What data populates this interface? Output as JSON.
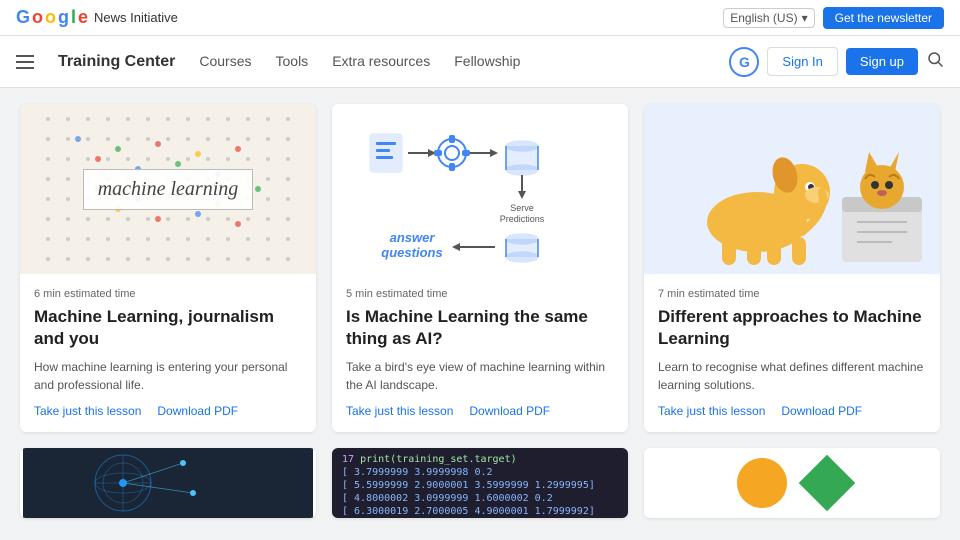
{
  "topbar": {
    "google_text": "Google",
    "title": "News Initiative",
    "language": "English (US)",
    "newsletter_btn": "Get the newsletter"
  },
  "navbar": {
    "training_center": "Training Center",
    "links": [
      "Courses",
      "Tools",
      "Extra resources",
      "Fellowship"
    ],
    "sign_in": "Sign In",
    "sign_up": "Sign up"
  },
  "cards": [
    {
      "time": "6 min estimated time",
      "title": "Machine Learning, journalism and you",
      "desc": "How machine learning is entering your personal and professional life.",
      "link1": "Take just this lesson",
      "link2": "Download PDF"
    },
    {
      "time": "5 min estimated time",
      "title": "Is Machine Learning the same thing as AI?",
      "desc": "Take a bird's eye view of machine learning within the AI landscape.",
      "link1": "Take just this lesson",
      "link2": "Download PDF"
    },
    {
      "time": "7 min estimated time",
      "title": "Different approaches to Machine Learning",
      "desc": "Learn to recognise what defines different machine learning solutions.",
      "link1": "Take just this lesson",
      "link2": "Download PDF"
    }
  ],
  "code_snippet": {
    "line1": "print(training_set.target)",
    "line_num": "17",
    "rows": [
      "[ 3.7999999  3.9999998  0.2",
      "[ 5.5999999  2.9000001  3.5999999  1.2999995]",
      "[ 4.8000002  3.0999999  1.6000002  0.2",
      "[ 6.3000019  2.7000005  4.9000001  1.7999992]"
    ]
  }
}
